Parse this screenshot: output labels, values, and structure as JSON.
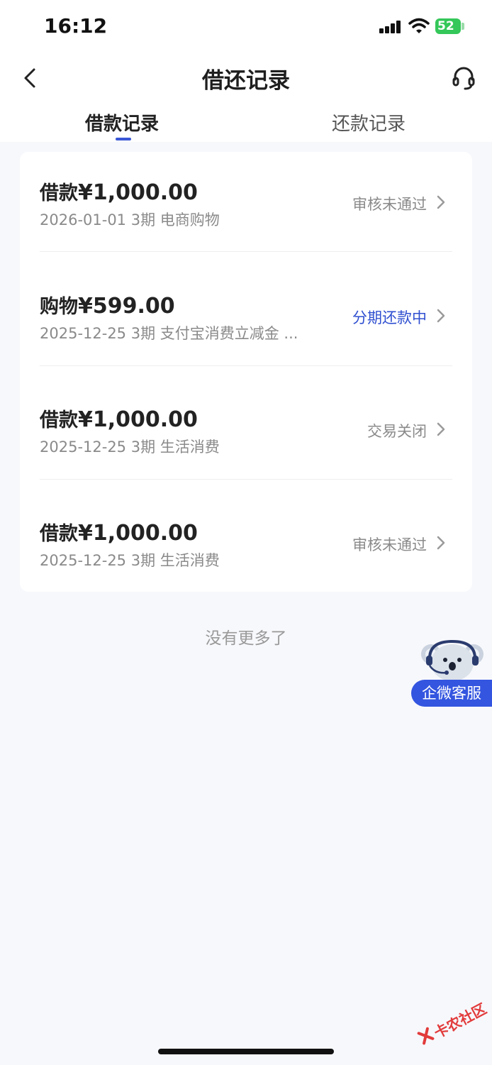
{
  "status_bar": {
    "time": "16:12",
    "battery": "52"
  },
  "header": {
    "title": "借还记录"
  },
  "tabs": [
    {
      "label": "借款记录",
      "active": true
    },
    {
      "label": "还款记录",
      "active": false
    }
  ],
  "records": [
    {
      "type": "借款",
      "amount": "¥1,000.00",
      "subtitle": "2026-01-01 3期  电商购物",
      "status": "审核未通过",
      "status_color": "#8a8a8a"
    },
    {
      "type": "购物",
      "amount": "¥599.00",
      "subtitle": "2025-12-25 3期  支付宝消费立减金 ...",
      "status": "分期还款中",
      "status_color": "#2f4fd0"
    },
    {
      "type": "借款",
      "amount": "¥1,000.00",
      "subtitle": "2025-12-25 3期  生活消费",
      "status": "交易关闭",
      "status_color": "#8a8a8a"
    },
    {
      "type": "借款",
      "amount": "¥1,000.00",
      "subtitle": "2025-12-25 3期  生活消费",
      "status": "审核未通过",
      "status_color": "#8a8a8a"
    }
  ],
  "footer": {
    "no_more": "没有更多了"
  },
  "float_service": {
    "label": "企微客服"
  },
  "watermark": {
    "text": "卡农社区"
  },
  "colors": {
    "accent": "#3a57d6",
    "service_blue": "#3355e0",
    "battery_green": "#34c759"
  }
}
